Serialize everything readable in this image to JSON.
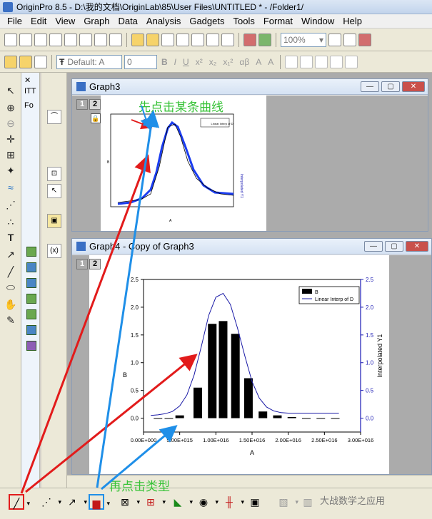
{
  "window": {
    "title": "OriginPro 8.5 - D:\\我的文档\\OriginLab\\85\\User Files\\UNTITLED * - /Folder1/"
  },
  "menu": [
    "File",
    "Edit",
    "View",
    "Graph",
    "Data",
    "Analysis",
    "Gadgets",
    "Tools",
    "Format",
    "Window",
    "Help"
  ],
  "toolbar": {
    "zoom_value": "100%",
    "font_combo": "Default: A",
    "size_combo": "0",
    "format_buttons": [
      "B",
      "I",
      "U",
      "x²",
      "x₂",
      "x₁²",
      "αβ",
      "A",
      "A"
    ]
  },
  "left_panel": {
    "labels": [
      "ITT",
      "Fo"
    ]
  },
  "graph3": {
    "title": "Graph3",
    "layers": [
      "1",
      "2"
    ],
    "legend": [
      "B",
      "Linear Interp of D"
    ],
    "xlabel": "A",
    "ylabel_left": "B",
    "ylabel_right": "Interpolated Y1",
    "x_ticks": [
      "0.00E+000",
      "5.00E+015",
      "1.00E+016",
      "1.50E+016",
      "2.00E+016",
      "2.50E+016",
      "3.00E+016"
    ],
    "y_right_ticks": [
      "0.0",
      "0.5",
      "1.0",
      "1.5",
      "2.0",
      "2.5"
    ]
  },
  "graph4": {
    "title": "Graph4 - Copy of Graph3",
    "layers": [
      "1",
      "2"
    ]
  },
  "annotations": {
    "first_step": "先点击某条曲线",
    "second_step": "再点击类型"
  },
  "watermark": "大战数学之应用",
  "colors": {
    "arrow_red": "#e21b1b",
    "arrow_blue": "#1f8fe8",
    "annotation_green": "#35c235",
    "bar_fill": "#000000",
    "line_series": "#1a1aa6",
    "axis_right": "#1a1ab3"
  },
  "chart_data": {
    "type": "bar",
    "xlabel": "A",
    "ylabel": "B",
    "y2label": "Interpolated Y1",
    "xlim": [
      0,
      3e+16
    ],
    "ylim": [
      -0.25,
      2.5
    ],
    "x_ticks": [
      "0.00E+000",
      "5.00E+015",
      "1.00E+016",
      "1.50E+016",
      "2.00E+016",
      "2.50E+016",
      "3.00E+016"
    ],
    "y_ticks": [
      "0.0",
      "0.5",
      "1.0",
      "1.5",
      "2.0",
      "2.5"
    ],
    "y2_ticks": [
      "0.0",
      "0.5",
      "1.0",
      "1.5",
      "2.0",
      "2.5"
    ],
    "grid": false,
    "legend_position": "top-right",
    "legend": [
      "B",
      "Linear Interp of D"
    ],
    "series": [
      {
        "name": "B",
        "type": "bar",
        "x": [
          2000000000000000.0,
          3500000000000000.0,
          5000000000000000.0,
          7500000000000000.0,
          9500000000000000.0,
          1.1e+16,
          1.27e+16,
          1.45e+16,
          1.65e+16,
          1.85e+16,
          2.05e+16,
          2.25e+16,
          2.45e+16,
          2.65e+16
        ],
        "values": [
          0,
          0,
          0.05,
          0.55,
          1.7,
          1.75,
          1.52,
          0.72,
          0.12,
          0.05,
          0.02,
          0,
          0,
          0
        ]
      },
      {
        "name": "Linear Interp of D",
        "type": "line",
        "x": [
          1000000000000000.0,
          2000000000000000.0,
          3000000000000000.0,
          4000000000000000.0,
          5000000000000000.0,
          6000000000000000.0,
          7000000000000000.0,
          8000000000000000.0,
          9000000000000000.0,
          1e+16,
          1.1e+16,
          1.2e+16,
          1.3e+16,
          1.4e+16,
          1.5e+16,
          1.6e+16,
          1.7e+16,
          1.8e+16,
          1.9e+16,
          2e+16,
          2.1e+16,
          2.2e+16,
          2.3e+16,
          2.4e+16,
          2.5e+16,
          2.6e+16,
          2.7e+16
        ],
        "values": [
          0.05,
          0.06,
          0.08,
          0.12,
          0.22,
          0.42,
          0.78,
          1.3,
          1.85,
          2.18,
          2.25,
          2.05,
          1.62,
          1.12,
          0.66,
          0.36,
          0.2,
          0.13,
          0.1,
          0.09,
          0.09,
          0.09,
          0.09,
          0.09,
          0.09,
          0.09,
          0.09
        ]
      }
    ]
  }
}
